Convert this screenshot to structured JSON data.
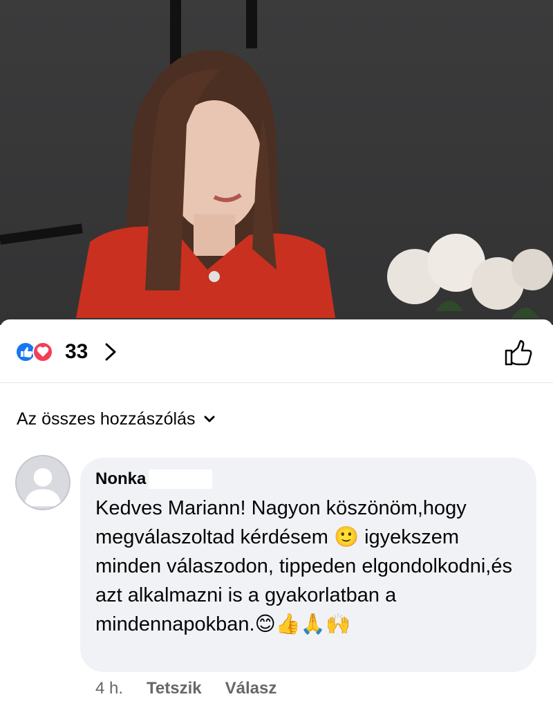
{
  "reactions": {
    "count": "33",
    "icons": [
      "like-icon",
      "love-icon"
    ],
    "like_color": "#1877f2",
    "love_color": "#f33e58"
  },
  "sort": {
    "label": "Az összes hozzászólás",
    "icon": "chevron-down-icon"
  },
  "comment": {
    "author": "Nonka",
    "text": "Kedves Mariann! Nagyon köszönöm,hogy megválaszoltad kérdésem 🙂 igyekszem minden válaszodon, tippeden elgondolkodni,és azt alkalmazni is a gyakorlatban a mindennapokban.😊👍🙏🙌",
    "time": "4 h.",
    "like_label": "Tetszik",
    "reply_label": "Válasz"
  }
}
